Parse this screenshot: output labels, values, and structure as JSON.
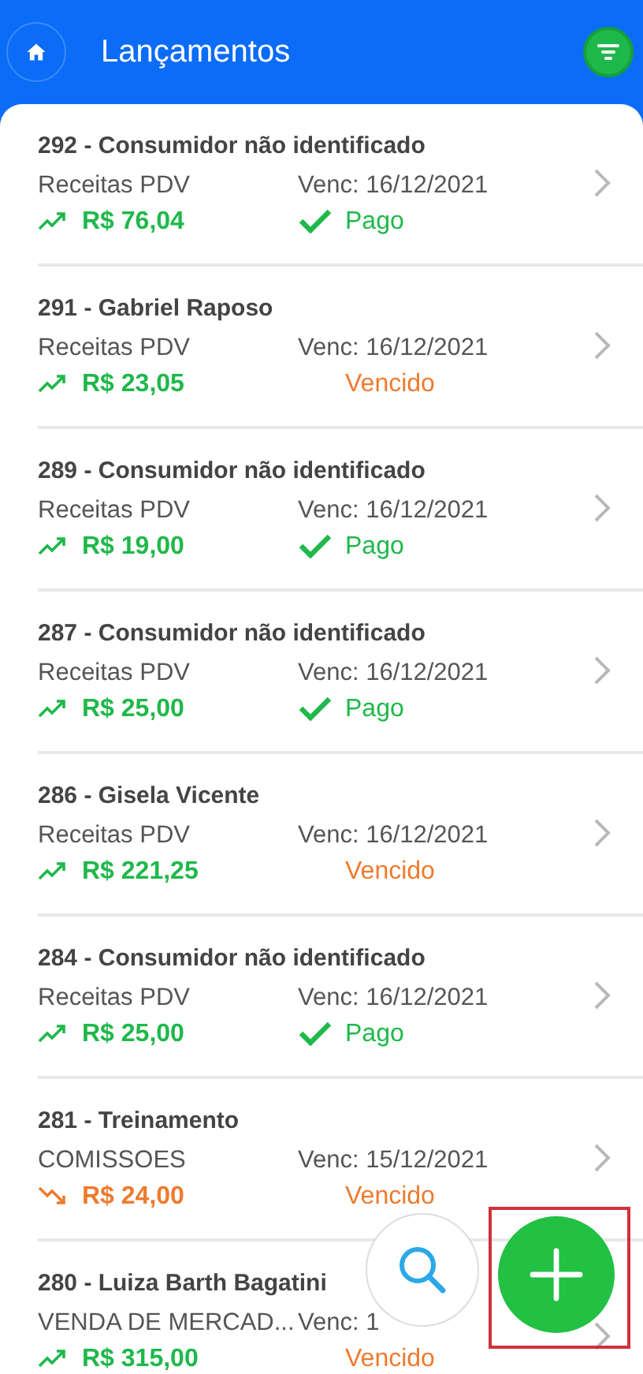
{
  "header": {
    "title": "Lançamentos"
  },
  "entries": [
    {
      "title": "292 - Consumidor não identificado",
      "category": "Receitas PDV",
      "due": "Venc: 16/12/2021",
      "amount": "R$ 76,04",
      "kind": "income",
      "status": {
        "kind": "paid",
        "label": "Pago"
      }
    },
    {
      "title": "291 - Gabriel Raposo",
      "category": "Receitas PDV",
      "due": "Venc: 16/12/2021",
      "amount": "R$ 23,05",
      "kind": "income",
      "status": {
        "kind": "overdue",
        "label": "Vencido"
      }
    },
    {
      "title": "289 - Consumidor não identificado",
      "category": "Receitas PDV",
      "due": "Venc: 16/12/2021",
      "amount": "R$ 19,00",
      "kind": "income",
      "status": {
        "kind": "paid",
        "label": "Pago"
      }
    },
    {
      "title": "287 - Consumidor não identificado",
      "category": "Receitas PDV",
      "due": "Venc: 16/12/2021",
      "amount": "R$ 25,00",
      "kind": "income",
      "status": {
        "kind": "paid",
        "label": "Pago"
      }
    },
    {
      "title": "286 - Gisela Vicente",
      "category": "Receitas PDV",
      "due": "Venc: 16/12/2021",
      "amount": "R$ 221,25",
      "kind": "income",
      "status": {
        "kind": "overdue",
        "label": "Vencido"
      }
    },
    {
      "title": "284 - Consumidor não identificado",
      "category": "Receitas PDV",
      "due": "Venc: 16/12/2021",
      "amount": "R$ 25,00",
      "kind": "income",
      "status": {
        "kind": "paid",
        "label": "Pago"
      }
    },
    {
      "title": "281 - Treinamento",
      "category": "COMISSOES",
      "due": "Venc: 15/12/2021",
      "amount": "R$ 24,00",
      "kind": "expense",
      "status": {
        "kind": "overdue",
        "label": "Vencido"
      }
    },
    {
      "title": "280 - Luiza Barth Bagatini",
      "category": "VENDA DE MERCAD...",
      "due": "Venc: 1",
      "amount": "R$ 315,00",
      "kind": "income",
      "status": {
        "kind": "overdue",
        "label": "Vencido"
      }
    }
  ]
}
